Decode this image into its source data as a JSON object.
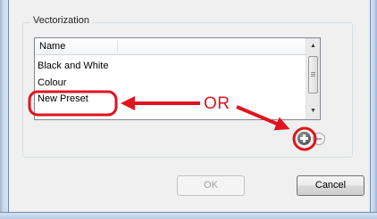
{
  "dialog": {
    "group_title": "Vectorization",
    "list": {
      "column_header": "Name",
      "rows": [
        "Black and White",
        "Colour",
        "New Preset"
      ]
    },
    "scrollbar": {
      "up_arrow": "▲",
      "down_arrow": "▼"
    },
    "ok_label": "OK",
    "cancel_label": "Cancel",
    "add_icon": "plus-circle-icon",
    "remove_icon": "minus-circle-icon"
  },
  "annotation": {
    "text": "OR",
    "color": "#e0141f"
  }
}
